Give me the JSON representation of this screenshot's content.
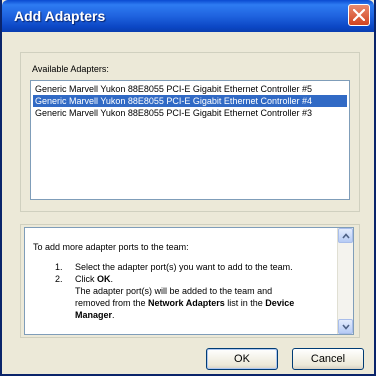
{
  "window": {
    "title": "Add Adapters"
  },
  "available": {
    "label": "Available Adapters:",
    "items": [
      {
        "label": "Generic Marvell Yukon 88E8055 PCI-E Gigabit Ethernet Controller #5",
        "selected": false
      },
      {
        "label": "Generic Marvell Yukon 88E8055 PCI-E Gigabit Ethernet Controller #4",
        "selected": true
      },
      {
        "label": "Generic Marvell Yukon 88E8055 PCI-E Gigabit Ethernet Controller #3",
        "selected": false
      }
    ]
  },
  "help": {
    "intro": "To add more adapter ports to the team:",
    "step1_num": "1.",
    "step1_text": "Select the adapter port(s) you want to add to the team.",
    "step2_num": "2.",
    "step2_text_prefix": "Click ",
    "step2_text_bold": "OK",
    "step2_text_suffix": ".",
    "note_line1": "The adapter port(s) will be added to the team and",
    "note_line2_prefix": "removed from the ",
    "note_line2_bold1": "Network Adapters",
    "note_line2_mid": " list in the ",
    "note_line2_bold2": "Device",
    "note_line3_bold": "Manager",
    "note_line3_suffix": "."
  },
  "buttons": {
    "ok": "OK",
    "cancel": "Cancel"
  },
  "colors": {
    "titlebar": "#1f63df",
    "selection": "#316ac5",
    "close": "#d2431f"
  },
  "icons": {
    "close": "close-icon",
    "scroll_up": "chevron-up-icon",
    "scroll_down": "chevron-down-icon"
  }
}
